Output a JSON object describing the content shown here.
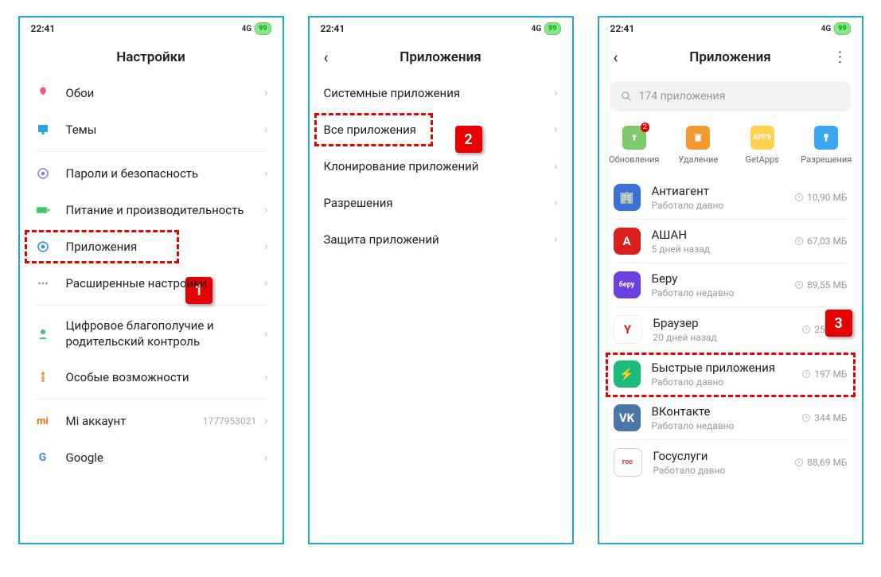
{
  "status": {
    "time": "22:41",
    "net": "4G",
    "battery": "99"
  },
  "screen1": {
    "title": "Настройки",
    "items": [
      {
        "label": "Обои"
      },
      {
        "label": "Темы"
      },
      {
        "label": "Пароли и безопасность"
      },
      {
        "label": "Питание и производительность"
      },
      {
        "label": "Приложения"
      },
      {
        "label": "Расширенные настройки"
      },
      {
        "label": "Цифровое благополучие и родительский контроль"
      },
      {
        "label": "Особые возможности"
      },
      {
        "miaccount_label": "Mi аккаунт",
        "miaccount_value": "1777953021"
      },
      {
        "label": "Google"
      }
    ],
    "badge": "1"
  },
  "screen2": {
    "title": "Приложения",
    "items": [
      {
        "label": "Системные приложения"
      },
      {
        "label": "Все приложения"
      },
      {
        "label": "Клонирование приложений"
      },
      {
        "label": "Разрешения"
      },
      {
        "label": "Защита приложений"
      }
    ],
    "badge": "2"
  },
  "screen3": {
    "title": "Приложения",
    "search_placeholder": "174 приложения",
    "quick": [
      {
        "label": "Обновления",
        "badge": "2"
      },
      {
        "label": "Удаление"
      },
      {
        "label": "GetApps"
      },
      {
        "label": "Разрешения"
      }
    ],
    "apps": [
      {
        "name": "Антиагент",
        "sub": "Работало давно",
        "size": "10,90 МБ",
        "bg": "#3a6fd8",
        "glyph": "🏢"
      },
      {
        "name": "АШАН",
        "sub": "5 дней назад",
        "size": "67,03 МБ",
        "bg": "#d9201e",
        "glyph": "A"
      },
      {
        "name": "Беру",
        "sub": "Работало недавно",
        "size": "89,55 МБ",
        "bg": "#6b3fe0",
        "glyph": "беру"
      },
      {
        "name": "Браузер",
        "sub": "20 дней назад",
        "size": "255 МБ",
        "bg": "#ffffff",
        "glyph": "Y",
        "fg": "#d02020",
        "border": "#eee"
      },
      {
        "name": "Быстрые приложения",
        "sub": "Работало давно",
        "size": "197 МБ",
        "bg": "#1abc7b",
        "glyph": "⚡"
      },
      {
        "name": "ВКонтакте",
        "sub": "Работало недавно",
        "size": "344 МБ",
        "bg": "#4a76a8",
        "glyph": "VK"
      },
      {
        "name": "Госуслуги",
        "sub": "Работало давно",
        "size": "88,69 МБ",
        "bg": "#ffffff",
        "glyph": "гос",
        "fg": "#c33",
        "border": "#b9d7e8"
      }
    ],
    "badge": "3"
  }
}
